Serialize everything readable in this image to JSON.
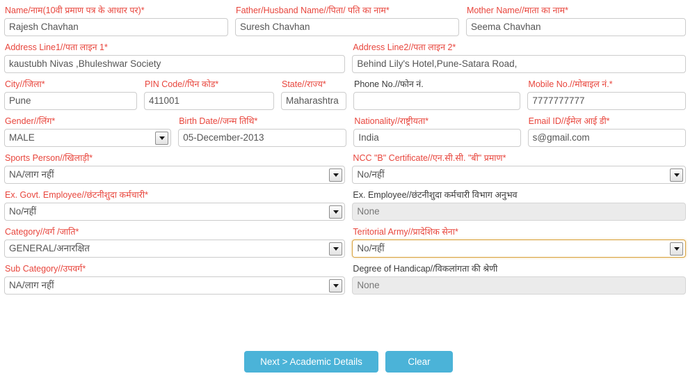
{
  "form": {
    "rows": [
      {
        "fields": [
          {
            "label": "Name/नाम(10वी प्रमाण पत्र के आधार पर)*",
            "value": "Rajesh Chavhan",
            "type": "text",
            "required": true
          },
          {
            "label": "Father/Husband Name//पिता/ पति का नाम*",
            "value": "Suresh Chavhan",
            "type": "text",
            "required": true
          },
          {
            "label": "Mother Name//माता का नाम*",
            "value": "Seema Chavhan",
            "type": "text",
            "required": true
          }
        ]
      },
      {
        "fields": [
          {
            "label": "Address Line1//पता लाइन 1*",
            "value": "kaustubh Nivas ,Bhuleshwar Society",
            "type": "text",
            "required": true
          },
          {
            "label": "Address Line2//पता लाइन 2*",
            "value": "Behind Lily's Hotel,Pune-Satara Road,",
            "type": "text",
            "required": true
          }
        ]
      },
      {
        "fields": [
          {
            "label": "City//जिला*",
            "value": "Pune",
            "type": "text",
            "required": true
          },
          {
            "label": "PIN Code//पिन कोड*",
            "value": "411001",
            "type": "text",
            "required": true
          },
          {
            "label": "State//राज्य*",
            "value": "Maharashtra",
            "type": "text",
            "required": true
          },
          {
            "label": "Phone No.//फोन नं.",
            "value": "",
            "type": "text",
            "required": false
          },
          {
            "label": "Mobile No.//मोबाइल नं.*",
            "value": "7777777777",
            "type": "text",
            "required": true
          }
        ]
      },
      {
        "fields": [
          {
            "label": "Gender//लिंग*",
            "value": "MALE",
            "type": "select",
            "required": true
          },
          {
            "label": "Birth Date//जन्म तिथि*",
            "value": "05-December-2013",
            "type": "text",
            "required": true
          },
          {
            "label": "Nationality//राष्ट्रीयता*",
            "value": "India",
            "type": "text",
            "required": true
          },
          {
            "label": "Email ID//ईमेल आई डी*",
            "value": "s@gmail.com",
            "type": "text",
            "required": true
          }
        ]
      },
      {
        "fields": [
          {
            "label": "Sports Person//खिलाड़ी*",
            "value": "NA/लाग नहीं",
            "type": "select",
            "required": true
          },
          {
            "label": "NCC \"B\" Certificate//एन.सी.सी. \"बी\" प्रमाण*",
            "value": "No/नहीं",
            "type": "select",
            "required": true
          }
        ]
      },
      {
        "fields": [
          {
            "label": "Ex. Govt. Employee//छंटनीशुदा कर्मचारी*",
            "value": "No/नहीं",
            "type": "select",
            "required": true
          },
          {
            "label": "Ex. Employee//छंटनीशुदा कर्मचारी विभाग अनुभव",
            "value": "None",
            "type": "text",
            "required": false,
            "disabled": true
          }
        ]
      },
      {
        "fields": [
          {
            "label": "Category//वर्ग /जाति*",
            "value": "GENERAL/अनारक्षित",
            "type": "select",
            "required": true
          },
          {
            "label": "Teritorial Army//प्रादेशिक सेना*",
            "value": "No/नहीं",
            "type": "select",
            "required": true,
            "focused": true
          }
        ]
      },
      {
        "fields": [
          {
            "label": "Sub Category//उपवर्ग*",
            "value": "NA/लाग नहीं",
            "type": "select",
            "required": true
          },
          {
            "label": "Degree of Handicap//विकलांगता की श्रेणी",
            "value": "None",
            "type": "text",
            "required": false,
            "disabled": true
          }
        ]
      }
    ]
  },
  "buttons": {
    "next_label": "Next > Academic Details",
    "clear_label": "Clear"
  },
  "colors": {
    "required_label": "#e8453c",
    "optional_label": "#3a3a3a",
    "button": "#4bb3d8",
    "focus_border": "#d9a441"
  }
}
